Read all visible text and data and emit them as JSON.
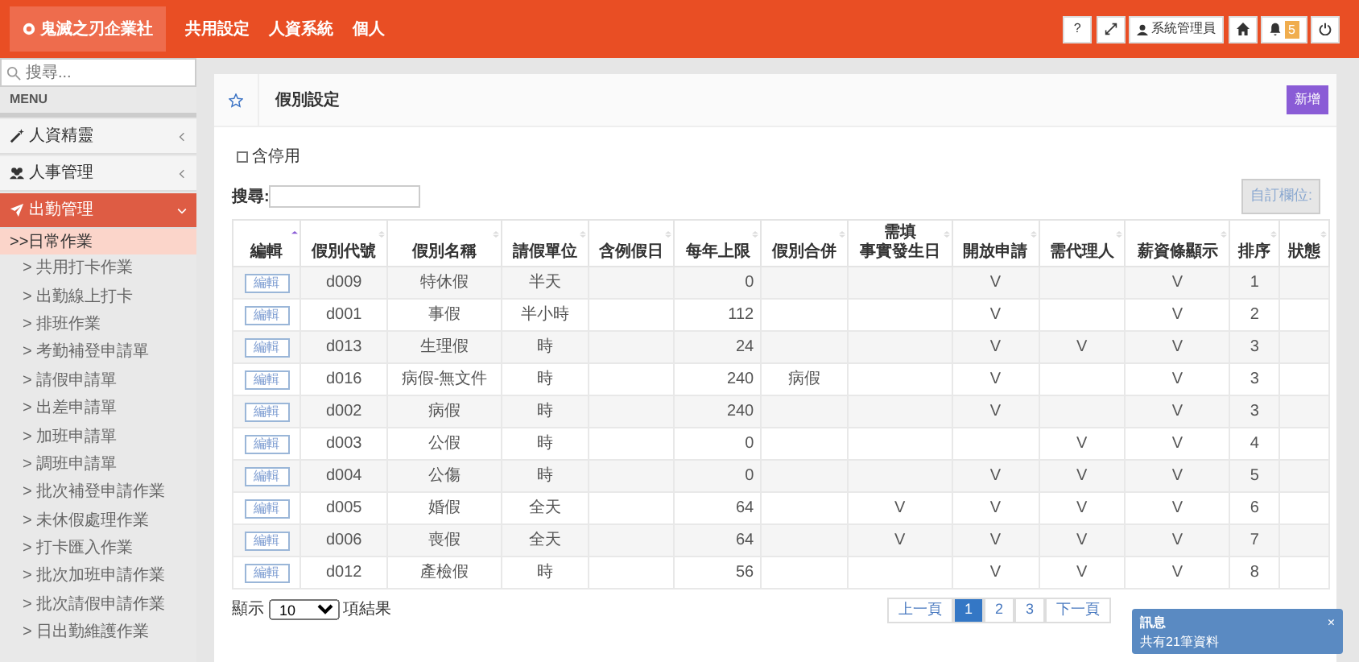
{
  "topbar": {
    "brand": "鬼滅之刃企業社",
    "nav": [
      "共用設定",
      "人資系統",
      "個人"
    ],
    "help": "?",
    "user": "系統管理員",
    "notifications": "5"
  },
  "sidebar": {
    "search": {
      "placeholder": "搜尋..."
    },
    "menu_label": "MENU",
    "items": [
      {
        "label": "人資精靈",
        "selected": false,
        "expanded": false
      },
      {
        "label": "人事管理",
        "selected": false,
        "expanded": false
      },
      {
        "label": "出勤管理",
        "selected": true,
        "expanded": true,
        "children": [
          {
            "label": ">>日常作業",
            "selected": true,
            "children": [
              {
                "label": "> 共用打卡作業"
              },
              {
                "label": "> 出勤線上打卡"
              },
              {
                "label": "> 排班作業"
              },
              {
                "label": "> 考勤補登申請單"
              },
              {
                "label": "> 請假申請單"
              },
              {
                "label": "> 出差申請單"
              },
              {
                "label": "> 加班申請單"
              },
              {
                "label": "> 調班申請單"
              },
              {
                "label": "> 批次補登申請作業"
              },
              {
                "label": "> 未休假處理作業"
              },
              {
                "label": "> 打卡匯入作業"
              },
              {
                "label": "> 批次加班申請作業"
              },
              {
                "label": "> 批次請假申請作業"
              },
              {
                "label": "> 日出勤維護作業"
              }
            ]
          }
        ]
      }
    ]
  },
  "page": {
    "title": "假別設定",
    "new_button": "新增",
    "include_disabled": {
      "label": "含停用",
      "checked": false
    },
    "search": {
      "label": "搜尋:"
    },
    "custom_columns_button": "自訂欄位:"
  },
  "table": {
    "columns": [
      {
        "lines": [
          "編輯"
        ],
        "sorted": true
      },
      {
        "lines": [
          "假別代號"
        ],
        "sorted": false
      },
      {
        "lines": [
          "假別名稱"
        ],
        "sorted": false
      },
      {
        "lines": [
          "請假單位"
        ],
        "sorted": false
      },
      {
        "lines": [
          "含例假日"
        ],
        "sorted": false
      },
      {
        "lines": [
          "每年上限"
        ],
        "sorted": false
      },
      {
        "lines": [
          "假別合併"
        ],
        "sorted": false
      },
      {
        "lines": [
          "需填",
          "事實發生日"
        ],
        "sorted": false
      },
      {
        "lines": [
          "開放申請"
        ],
        "sorted": false
      },
      {
        "lines": [
          "需代理人"
        ],
        "sorted": false
      },
      {
        "lines": [
          "薪資條顯示"
        ],
        "sorted": false
      },
      {
        "lines": [
          "排序"
        ],
        "sorted": false
      },
      {
        "lines": [
          "狀態"
        ],
        "sorted": false
      }
    ],
    "rows": [
      {
        "cells": [
          "編輯",
          "d009",
          "特休假",
          "半天",
          null,
          "0",
          null,
          null,
          "V",
          null,
          "V",
          "1",
          null
        ]
      },
      {
        "cells": [
          "編輯",
          "d001",
          "事假",
          "半小時",
          null,
          "112",
          null,
          null,
          "V",
          null,
          "V",
          "2",
          null
        ]
      },
      {
        "cells": [
          "編輯",
          "d013",
          "生理假",
          "時",
          null,
          "24",
          null,
          null,
          "V",
          "V",
          "V",
          "3",
          null
        ]
      },
      {
        "cells": [
          "編輯",
          "d016",
          "病假-無文件",
          "時",
          null,
          "240",
          "病假",
          null,
          "V",
          null,
          "V",
          "3",
          null
        ]
      },
      {
        "cells": [
          "編輯",
          "d002",
          "病假",
          "時",
          null,
          "240",
          null,
          null,
          "V",
          null,
          "V",
          "3",
          null
        ]
      },
      {
        "cells": [
          "編輯",
          "d003",
          "公假",
          "時",
          null,
          "0",
          null,
          null,
          null,
          "V",
          "V",
          "4",
          null
        ]
      },
      {
        "cells": [
          "編輯",
          "d004",
          "公傷",
          "時",
          null,
          "0",
          null,
          null,
          "V",
          "V",
          "V",
          "5",
          null
        ]
      },
      {
        "cells": [
          "編輯",
          "d005",
          "婚假",
          "全天",
          null,
          "64",
          null,
          "V",
          "V",
          "V",
          "V",
          "6",
          null
        ]
      },
      {
        "cells": [
          "編輯",
          "d006",
          "喪假",
          "全天",
          null,
          "64",
          null,
          "V",
          "V",
          "V",
          "V",
          "7",
          null
        ]
      },
      {
        "cells": [
          "編輯",
          "d012",
          "產檢假",
          "時",
          null,
          "56",
          null,
          null,
          "V",
          "V",
          "V",
          "8",
          null
        ]
      }
    ]
  },
  "footer": {
    "length": {
      "before": "顯示",
      "value": "10",
      "after": "項結果"
    },
    "pagination": [
      {
        "label": "上一頁",
        "selected": false
      },
      {
        "label": "1",
        "selected": true
      },
      {
        "label": "2",
        "selected": false
      },
      {
        "label": "3",
        "selected": false
      },
      {
        "label": "下一頁",
        "selected": false
      }
    ]
  },
  "toast": {
    "title": "訊息",
    "message": "共有21筆資料",
    "close": "×"
  }
}
